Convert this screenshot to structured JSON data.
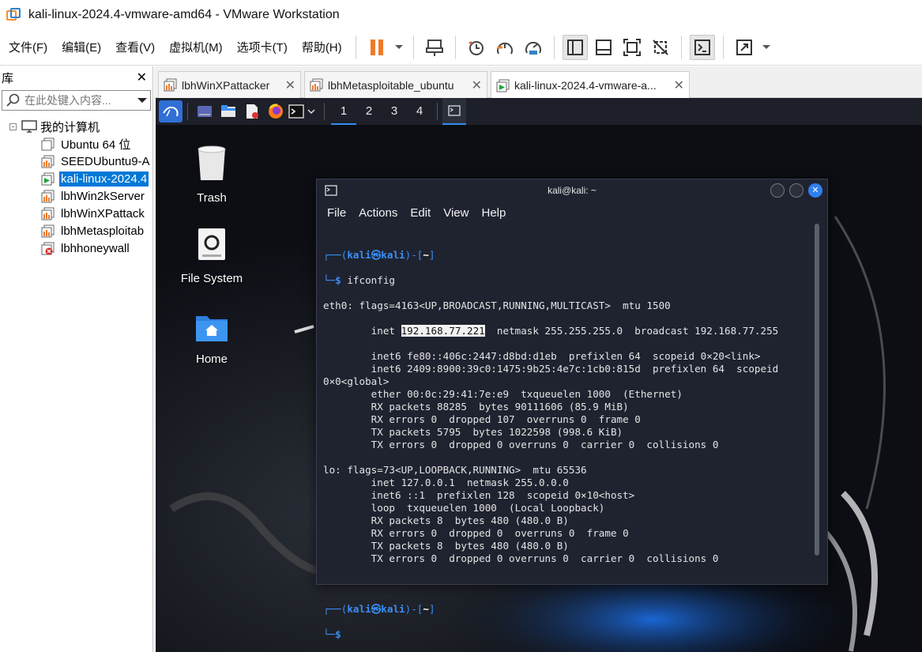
{
  "window": {
    "title": "kali-linux-2024.4-vmware-amd64 - VMware Workstation"
  },
  "menubar": [
    "文件(F)",
    "编辑(E)",
    "查看(V)",
    "虚拟机(M)",
    "选项卡(T)",
    "帮助(H)"
  ],
  "toolbar_icons": [
    "pause-icon",
    "dropdown-arrow-icon",
    "send-keys-icon",
    "snapshot-icon",
    "revert-snapshot-icon",
    "snapshot-manager-icon",
    "library-view-icon",
    "console-view-icon",
    "fullscreen-icon",
    "unity-icon",
    "terminal-icon",
    "stretch-icon",
    "dropdown-arrow-icon"
  ],
  "sidebar": {
    "title": "库",
    "search_placeholder": "在此处键入内容...",
    "root": "我的计算机",
    "items": [
      {
        "label": "Ubuntu 64 位",
        "state": "off"
      },
      {
        "label": "SEEDUbuntu9-A",
        "state": "shared"
      },
      {
        "label": "kali-linux-2024.4",
        "state": "running"
      },
      {
        "label": "lbhWin2kServer",
        "state": "shared"
      },
      {
        "label": "lbhWinXPattack",
        "state": "shared"
      },
      {
        "label": "lbhMetasploitab",
        "state": "shared"
      },
      {
        "label": "lbhhoneywall",
        "state": "error"
      }
    ]
  },
  "tabs": [
    {
      "label": "lbhWinXPattacker",
      "active": false
    },
    {
      "label": "lbhMetasploitable_ubuntu",
      "active": false
    },
    {
      "label": "kali-linux-2024.4-vmware-a...",
      "active": true
    }
  ],
  "kali": {
    "workspaces": [
      "1",
      "2",
      "3",
      "4"
    ],
    "desktop_icons": [
      {
        "label": "Trash",
        "icon": "trash-icon"
      },
      {
        "label": "File System",
        "icon": "drive-icon"
      },
      {
        "label": "Home",
        "icon": "home-folder-icon"
      }
    ],
    "terminal": {
      "title": "kali@kali: ~",
      "menu": [
        "File",
        "Actions",
        "Edit",
        "View",
        "Help"
      ],
      "prompt_user": "kali",
      "prompt_host": "kali",
      "prompt_dir": "~",
      "command": "ifconfig",
      "highlighted_ip": "192.168.77.221",
      "eth0_line1": "eth0: flags=4163<UP,BROADCAST,RUNNING,MULTICAST>  mtu 1500",
      "eth0_inet_prefix": "        inet ",
      "eth0_inet_suffix": "  netmask 255.255.255.0  broadcast 192.168.77.255",
      "eth0_rest": [
        "        inet6 fe80::406c:2447:d8bd:d1eb  prefixlen 64  scopeid 0×20<link>",
        "        inet6 2409:8900:39c0:1475:9b25:4e7c:1cb0:815d  prefixlen 64  scopeid",
        "0×0<global>",
        "        ether 00:0c:29:41:7e:e9  txqueuelen 1000  (Ethernet)",
        "        RX packets 88285  bytes 90111606 (85.9 MiB)",
        "        RX errors 0  dropped 107  overruns 0  frame 0",
        "        TX packets 5795  bytes 1022598 (998.6 KiB)",
        "        TX errors 0  dropped 0 overruns 0  carrier 0  collisions 0",
        "",
        "lo: flags=73<UP,LOOPBACK,RUNNING>  mtu 65536",
        "        inet 127.0.0.1  netmask 255.0.0.0",
        "        inet6 ::1  prefixlen 128  scopeid 0×10<host>",
        "        loop  txqueuelen 1000  (Local Loopback)",
        "        RX packets 8  bytes 480 (480.0 B)",
        "        RX errors 0  dropped 0  overruns 0  frame 0",
        "        TX packets 8  bytes 480 (480.0 B)",
        "        TX errors 0  dropped 0 overruns 0  carrier 0  collisions 0",
        "",
        ""
      ]
    }
  },
  "colors": {
    "accent": "#0078d7",
    "kali_blue": "#3a8ff5",
    "pause_orange": "#f07a28",
    "terminal_bg": "#1f2330"
  }
}
